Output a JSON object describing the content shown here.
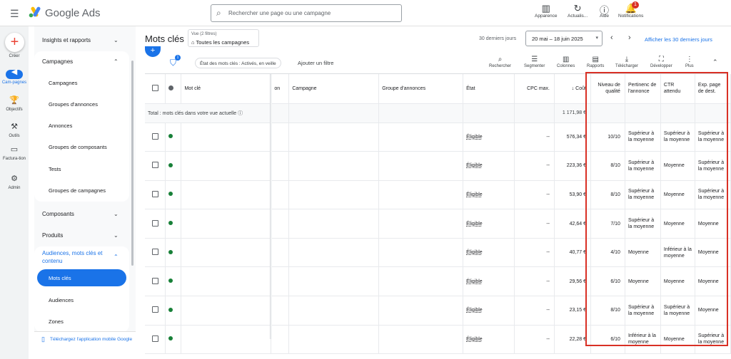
{
  "topbar": {
    "brand": "Google Ads",
    "search_placeholder": "Rechercher une page ou une campagne",
    "buttons": [
      {
        "label": "Apparence",
        "icon": "appearance-icon"
      },
      {
        "label": "Actualis...",
        "icon": "refresh-icon"
      },
      {
        "label": "Aide",
        "icon": "help-icon"
      },
      {
        "label": "Notifications",
        "icon": "bell-icon"
      }
    ],
    "notif_count": "1"
  },
  "rail": {
    "create": "Créer",
    "items": [
      {
        "label": "Cam-pagnes",
        "icon": "campaigns-icon"
      },
      {
        "label": "Objectifs",
        "icon": "trophy-icon"
      },
      {
        "label": "Outils",
        "icon": "tools-icon"
      },
      {
        "label": "Factura-tion",
        "icon": "billing-icon"
      },
      {
        "label": "Admin",
        "icon": "gear-icon"
      }
    ]
  },
  "nav": {
    "insights": "Insights et rapports",
    "campagnes_head": "Campagnes",
    "campagnes_items": [
      "Campagnes",
      "Groupes d'annonces",
      "Annonces",
      "Groupes de composants",
      "Tests",
      "Groupes de campagnes"
    ],
    "composants": "Composants",
    "produits": "Produits",
    "audiences_head": "Audiences, mots clés et contenu",
    "audiences_items": [
      "Mots clés",
      "Audiences",
      "Zones"
    ],
    "app_link": "Téléchargez l'application mobile Google"
  },
  "header": {
    "title": "Mots clés",
    "view_filters": "Vue (2 filtres)",
    "view_label": "Toutes les campagnes",
    "period": "30 derniers jours",
    "date_range": "20 mai – 18 juin 2025",
    "show_30": "Afficher les 30 derniers jours"
  },
  "toolbar": {
    "filter_count": "1",
    "chip": "État des mots clés : Activés, en veille",
    "add_filter": "Ajouter un filtre",
    "buttons": [
      "Rechercher",
      "Segmenter",
      "Colonnes",
      "Rapports",
      "Télécharger",
      "Développer",
      "Plus"
    ]
  },
  "table": {
    "headers": {
      "keyword": "Mot clé",
      "on": "on",
      "campaign": "Campagne",
      "adgroup": "Groupe d'annonces",
      "status": "État",
      "cpc": "CPC max.",
      "cost": "Coût",
      "quality": "Niveau de qualité",
      "relevance": "Pertinenc de l'annonce",
      "ctr": "CTR attendu",
      "landing": "Exp. page de dest."
    },
    "total_label": "Total : mots clés dans votre vue actuelle",
    "total_cost": "1 171,98 €",
    "rows": [
      {
        "status": "Éligible",
        "cpc": "--",
        "cost": "576,34 €",
        "quality": "10/10",
        "relevance": "Supérieur à la moyenne",
        "ctr": "Supérieur à la moyenne",
        "landing": "Supérieur à la moyenne"
      },
      {
        "status": "Éligible",
        "cpc": "--",
        "cost": "223,36 €",
        "quality": "8/10",
        "relevance": "Supérieur à la moyenne",
        "ctr": "Moyenne",
        "landing": "Supérieur à la moyenne"
      },
      {
        "status": "Éligible",
        "cpc": "--",
        "cost": "53,90 €",
        "quality": "8/10",
        "relevance": "Supérieur à la moyenne",
        "ctr": "Moyenne",
        "landing": "Supérieur à la moyenne"
      },
      {
        "status": "Éligible",
        "cpc": "--",
        "cost": "42,64 €",
        "quality": "7/10",
        "relevance": "Supérieur à la moyenne",
        "ctr": "Moyenne",
        "landing": "Moyenne"
      },
      {
        "status": "Éligible",
        "cpc": "--",
        "cost": "40,77 €",
        "quality": "4/10",
        "relevance": "Moyenne",
        "ctr": "Inférieur à la moyenne",
        "landing": "Moyenne"
      },
      {
        "status": "Éligible",
        "cpc": "--",
        "cost": "29,56 €",
        "quality": "6/10",
        "relevance": "Moyenne",
        "ctr": "Moyenne",
        "landing": "Moyenne"
      },
      {
        "status": "Éligible",
        "cpc": "--",
        "cost": "23,15 €",
        "quality": "8/10",
        "relevance": "Supérieur à la moyenne",
        "ctr": "Supérieur à la moyenne",
        "landing": "Moyenne"
      },
      {
        "status": "Éligible",
        "cpc": "--",
        "cost": "22,28 €",
        "quality": "6/10",
        "relevance": "Inférieur à la moyenne",
        "ctr": "Moyenne",
        "landing": "Supérieur à la moyenne"
      }
    ]
  }
}
